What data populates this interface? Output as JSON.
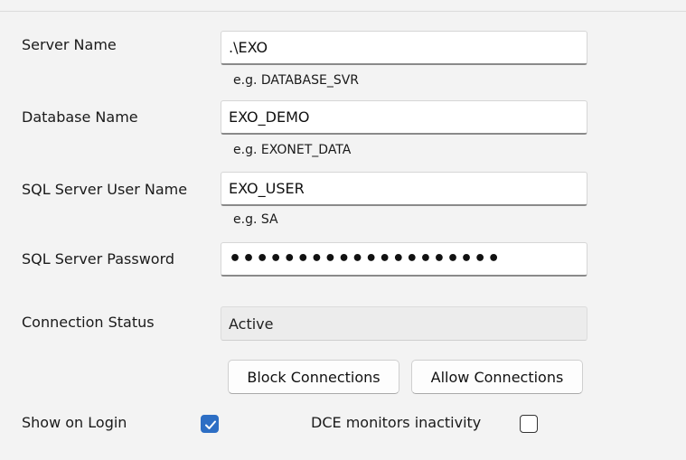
{
  "form": {
    "server_name": {
      "label": "Server Name",
      "value": ".\\EXO",
      "hint": "e.g. DATABASE_SVR"
    },
    "database_name": {
      "label": "Database Name",
      "value": "EXO_DEMO",
      "hint": "e.g. EXONET_DATA"
    },
    "sql_user_name": {
      "label": "SQL Server User Name",
      "value": "EXO_USER",
      "hint": "e.g. SA"
    },
    "sql_password": {
      "label": "SQL Server Password",
      "value": "••••••••••••••••••••"
    },
    "connection_status": {
      "label": "Connection Status",
      "value": "Active"
    }
  },
  "buttons": {
    "block_connections": "Block Connections",
    "allow_connections": "Allow Connections"
  },
  "options": {
    "show_on_login": {
      "label": "Show on Login",
      "checked": true
    },
    "dce_monitors_inactivity": {
      "label": "DCE monitors inactivity",
      "checked": false
    }
  },
  "colors": {
    "checkbox_accent": "#2d6ec4"
  }
}
